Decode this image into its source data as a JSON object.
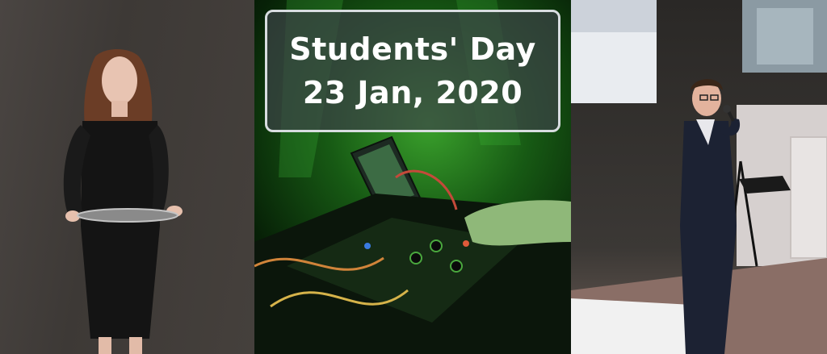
{
  "banner": {
    "title": "Students' Day",
    "date": "23 Jan, 2020"
  },
  "photos": {
    "left": "woman-holding-tray-photo",
    "middle": "dj-mixer-green-light-photo",
    "right": "man-speaking-microphone-photo"
  },
  "colors": {
    "text": "#ffffff",
    "box_border": "#d8dde0",
    "box_fill": "#3c4246",
    "stage_green": "#3aa12c"
  }
}
